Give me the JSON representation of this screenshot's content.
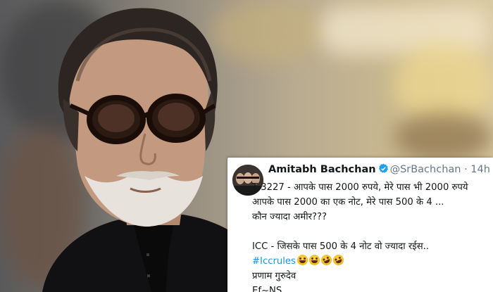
{
  "tweet": {
    "name": "Amitabh Bachchan",
    "handle": "@SrBachchan",
    "separator": "·",
    "time": "14h",
    "lines": [
      "T 3227 - आपके पास 2000 रुपये,  मेरे पास भी 2000 रुपये",
      "आपके पास 2000 का एक नोट, मेरे पास 500 के 4 ...",
      "कौन ज्यादा अमीर???",
      "ICC - जिसके पास 500 के 4 नोट वो ज्यादा रईस..",
      "प्रणाम गुरुदेव",
      "Ef~NS"
    ],
    "hashtag": "#Iccrules",
    "emojis": [
      "laughing-emoji",
      "laughing-emoji",
      "rolling-laughing-emoji",
      "rolling-laughing-emoji"
    ]
  },
  "colors": {
    "hashtag": "#1b95e0",
    "verified": "#1da1f2",
    "muted": "#657786",
    "text": "#14171a"
  }
}
